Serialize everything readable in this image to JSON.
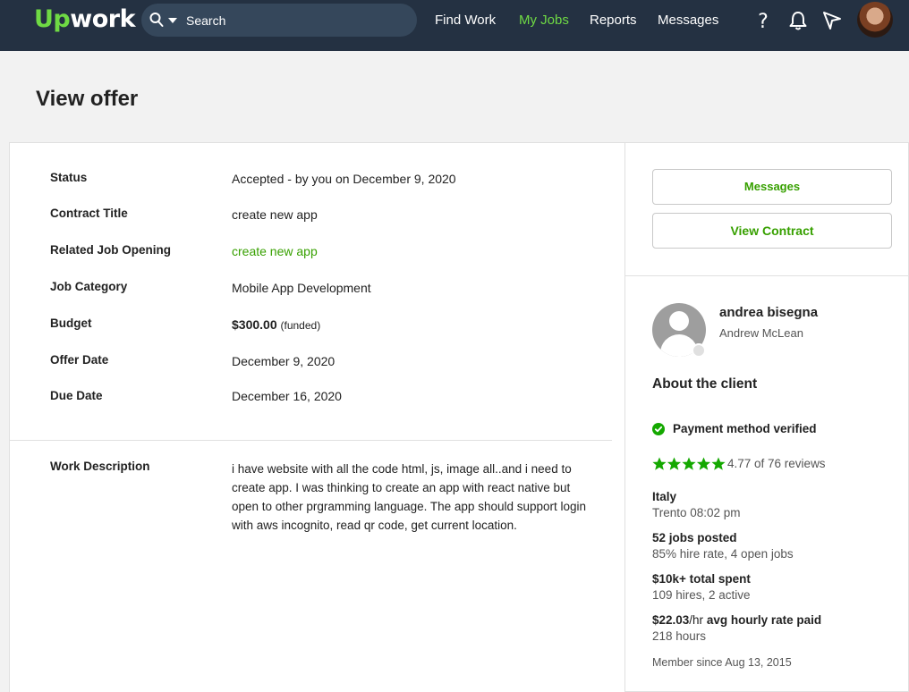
{
  "header": {
    "logo_up": "Up",
    "logo_work": "work",
    "search_placeholder": "Search",
    "nav": [
      "Find Work",
      "My Jobs",
      "Reports",
      "Messages"
    ],
    "active_nav": "My Jobs",
    "icons": [
      "help-icon",
      "notification-bell-icon",
      "send-icon",
      "avatar"
    ]
  },
  "page": {
    "title": "View offer"
  },
  "offer": {
    "rows": [
      {
        "label": "Status",
        "value": "Accepted - by you on December 9, 2020"
      },
      {
        "label": "Contract Title",
        "value": "create new app"
      },
      {
        "label": "Related Job Opening",
        "value": "create new app"
      },
      {
        "label": "Job Category",
        "value": "Mobile App Development"
      },
      {
        "label": "Budget",
        "value": "$300.00",
        "note": "(funded)"
      },
      {
        "label": "Offer Date",
        "value": "December 9, 2020"
      },
      {
        "label": "Due Date",
        "value": "December 16, 2020"
      }
    ],
    "work_description_label": "Work Description",
    "work_description": "i have website with all the code html, js, image all..and i need to create app. I was thinking to create an app with react native but open to other prgramming language. The app should support login with aws incognito, read qr code, get current location."
  },
  "actions": {
    "messages": "Messages",
    "view_contract": "View Contract"
  },
  "client": {
    "name": "andrea bisegna",
    "alias": "Andrew McLean",
    "about": "About the client",
    "payment_verified": "Payment method verified",
    "rating": 4.77,
    "rating_text": "4.77 of 76 reviews",
    "country": "Italy",
    "city_time": "Trento 08:02 pm",
    "jobs_posted": "52 jobs posted",
    "jobs_detail": "85% hire rate, 4 open jobs",
    "total_spent": "$10k+ total spent",
    "hires_detail": "109 hires, 2 active",
    "avg_rate": "$22.03",
    "avg_rate_unit": "/hr",
    "avg_rate_label": " avg hourly rate paid",
    "hours": "218 hours",
    "member_since": "Member since Aug 13, 2015"
  },
  "colors": {
    "header_bg": "#243142",
    "accent_green": "#6fda44",
    "link_green": "#37a000",
    "star_green": "#14a800"
  }
}
